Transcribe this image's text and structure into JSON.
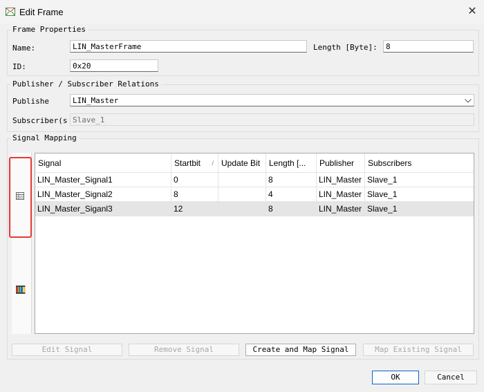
{
  "window": {
    "title": "Edit Frame"
  },
  "frame_properties": {
    "title": "Frame Properties",
    "name_label": "Name:",
    "name_value": "LIN_MasterFrame",
    "length_label": "Length [Byte]:",
    "length_value": "8",
    "id_label": "ID:",
    "id_value": "0x20"
  },
  "relations": {
    "title": "Publisher / Subscriber Relations",
    "publisher_label": "Publishe",
    "publisher_value": "LIN_Master",
    "subscriber_label": "Subscriber(s",
    "subscriber_value": "Slave_1"
  },
  "signal_mapping": {
    "title": "Signal Mapping",
    "columns": [
      "Signal",
      "Startbit",
      "Update Bit",
      "Length [...",
      "Publisher",
      "Subscribers"
    ],
    "rows": [
      [
        "LIN_Master_Signal1",
        "0",
        "",
        "8",
        "LIN_Master",
        "Slave_1"
      ],
      [
        "LIN_Master_Signal2",
        "8",
        "",
        "4",
        "LIN_Master",
        "Slave_1"
      ],
      [
        "LIN_Master_Siganl3",
        "12",
        "",
        "8",
        "LIN_Master",
        "Slave_1"
      ]
    ],
    "sort_indicator": "/"
  },
  "buttons": {
    "edit_signal": "Edit Signal",
    "remove_signal": "Remove Signal",
    "create_map_signal": "Create and Map Signal",
    "map_existing_signal": "Map Existing Signal",
    "ok": "OK",
    "cancel": "Cancel"
  },
  "colors": {
    "highlight_box": "#e53935",
    "selected_row": "#e5e5e5",
    "accent": "#0a64c8"
  }
}
